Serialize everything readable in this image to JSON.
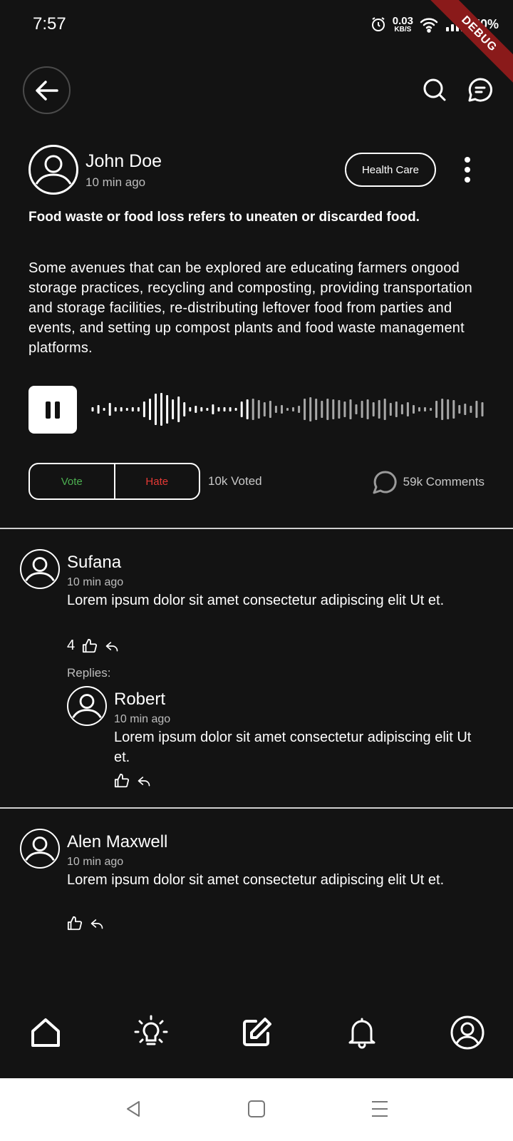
{
  "status_bar": {
    "time": "7:57",
    "net_speed": "0.03",
    "net_unit": "KB/S",
    "battery": "50%",
    "debug_label": "DEBUG"
  },
  "post": {
    "author": "John Doe",
    "time": "10 min ago",
    "tag": "Health Care",
    "title": "Food waste or food loss refers to uneaten or discarded food.",
    "body": "Some avenues that can be explored are educating farmers ongood storage practices, recycling and composting, providing transportation and storage facilities, re-distributing leftover food from parties and events, and setting up compost plants and food waste management platforms.",
    "vote_label": "Vote",
    "hate_label": "Hate",
    "voted_text": "10k Voted",
    "comments_text": "59k Comments"
  },
  "comments": [
    {
      "name": "Sufana",
      "time": "10 min ago",
      "text": "Lorem ipsum dolor sit amet consectetur adipiscing elit Ut et.",
      "likes": "4",
      "replies_label": "Replies:",
      "replies": [
        {
          "name": "Robert",
          "time": "10 min ago",
          "text": "Lorem ipsum dolor sit amet consectetur adipiscing elit Ut et."
        }
      ]
    },
    {
      "name": "Alen Maxwell",
      "time": "10 min ago",
      "text": "Lorem ipsum dolor sit amet consectetur adipiscing elit Ut et."
    }
  ],
  "bottom_nav": {
    "items": [
      "home-icon",
      "lightbulb-icon",
      "edit-icon",
      "bell-icon",
      "profile-icon"
    ]
  },
  "colors": {
    "background": "#131313",
    "vote": "#4caf50",
    "hate": "#e53935"
  }
}
